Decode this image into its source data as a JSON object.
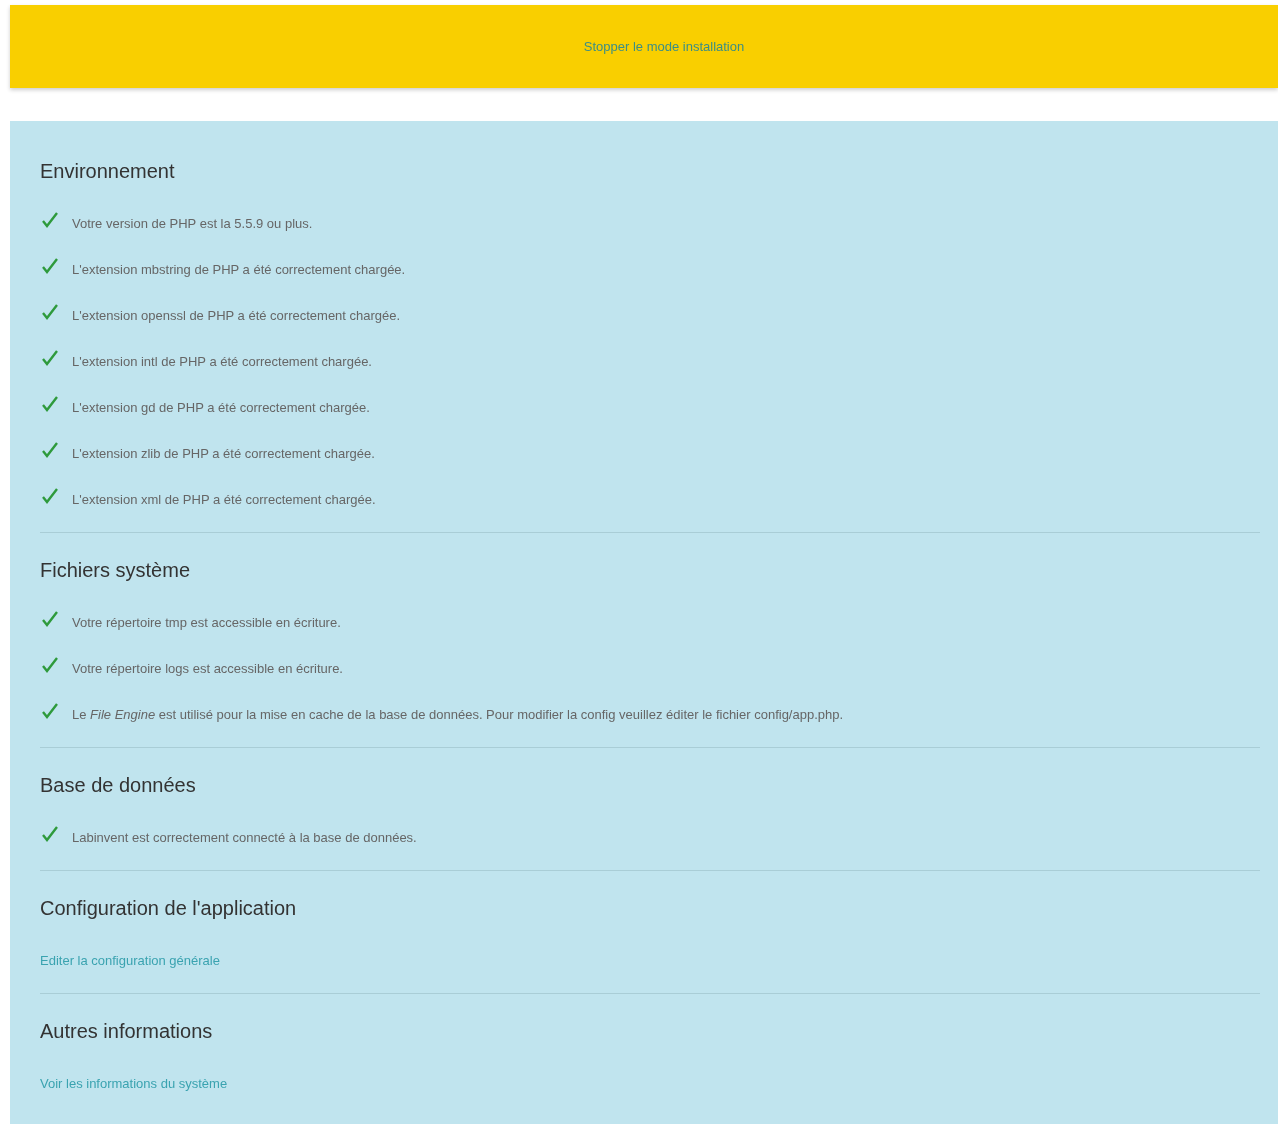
{
  "banner": {
    "link": "Stopper le mode installation"
  },
  "sections": [
    {
      "title": "Environnement",
      "items": [
        {
          "kind": "check",
          "ok": true,
          "text": "Votre version de PHP est la 5.5.9 ou plus."
        },
        {
          "kind": "check",
          "ok": true,
          "text": "L'extension mbstring de PHP a été correctement chargée."
        },
        {
          "kind": "check",
          "ok": true,
          "text": "L'extension openssl de PHP a été correctement chargée."
        },
        {
          "kind": "check",
          "ok": true,
          "text": "L'extension intl de PHP a été correctement chargée."
        },
        {
          "kind": "check",
          "ok": true,
          "text": "L'extension gd de PHP a été correctement chargée."
        },
        {
          "kind": "check",
          "ok": true,
          "text": "L'extension zlib de PHP a été correctement chargée."
        },
        {
          "kind": "check",
          "ok": true,
          "text": "L'extension xml de PHP a été correctement chargée."
        }
      ]
    },
    {
      "title": "Fichiers système",
      "items": [
        {
          "kind": "check",
          "ok": true,
          "text": "Votre répertoire tmp est accessible en écriture."
        },
        {
          "kind": "check",
          "ok": true,
          "text": "Votre répertoire logs est accessible en écriture."
        },
        {
          "kind": "check",
          "ok": true,
          "text": " Le *File Engine* est utilisé pour la mise en cache de la base de données. Pour modifier la config veuillez éditer le fichier config/app.php."
        }
      ]
    },
    {
      "title": "Base de données",
      "items": [
        {
          "kind": "check",
          "ok": true,
          "text": "Labinvent est correctement connecté à la base de données."
        }
      ]
    },
    {
      "title": "Configuration de l'application",
      "items": [
        {
          "kind": "link",
          "text": "Editer la configuration générale"
        }
      ]
    },
    {
      "title": "Autres informations",
      "items": [
        {
          "kind": "link",
          "text": "Voir les informations du système"
        }
      ]
    }
  ]
}
